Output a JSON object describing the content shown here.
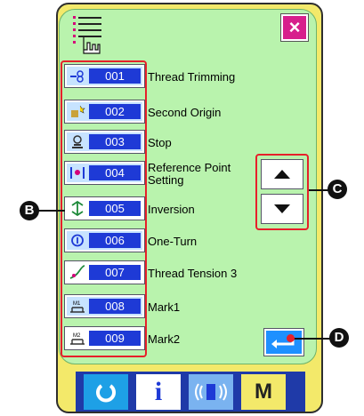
{
  "header": {
    "mode_icon": "thread-list-pointer-icon",
    "close_label": "×"
  },
  "rows": [
    {
      "code": "001",
      "label": "Thread Trimming",
      "icon": "thread-trimming-icon"
    },
    {
      "code": "002",
      "label": "Second Origin",
      "icon": "second-origin-icon"
    },
    {
      "code": "003",
      "label": "Stop",
      "icon": "stop-icon"
    },
    {
      "code": "004",
      "label": "Reference Point\nSetting",
      "icon": "reference-point-icon"
    },
    {
      "code": "005",
      "label": "Inversion",
      "icon": "inversion-icon"
    },
    {
      "code": "006",
      "label": "One-Turn",
      "icon": "one-turn-icon"
    },
    {
      "code": "007",
      "label": "Thread Tension 3",
      "icon": "thread-tension-icon"
    },
    {
      "code": "008",
      "label": "Mark1",
      "icon": "mark1-icon",
      "icon_text": "M1"
    },
    {
      "code": "009",
      "label": "Mark2",
      "icon": "mark2-icon",
      "icon_text": "M2"
    }
  ],
  "scroll": {
    "up_icon": "up-arrow-icon",
    "down_icon": "down-arrow-icon"
  },
  "enter": {
    "icon": "enter-icon"
  },
  "callouts": {
    "b": "B",
    "c": "C",
    "d": "D"
  },
  "toolbar": [
    {
      "name": "reset-button",
      "icon": "reset-icon"
    },
    {
      "name": "info-button",
      "icon": "info-icon",
      "label": "i"
    },
    {
      "name": "communication-button",
      "icon": "communication-icon"
    },
    {
      "name": "mode-button",
      "icon": "mode-icon",
      "label": "M"
    }
  ],
  "colors": {
    "screen": "#b9f3ad",
    "frame": "#f3e96a",
    "code_bg": "#1e3ad6",
    "highlight": "#e6202a",
    "close": "#d71f8c"
  }
}
